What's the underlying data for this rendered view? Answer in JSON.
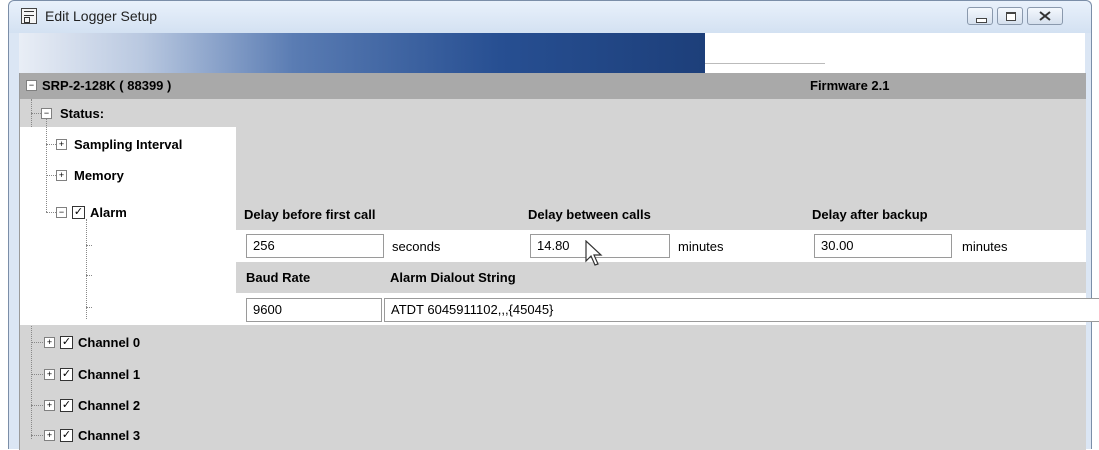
{
  "window": {
    "title": "Edit Logger Setup"
  },
  "device": {
    "name": "SRP-2-128K ( 88399 )",
    "firmware": "Firmware 2.1"
  },
  "tree": {
    "status_label": "Status:",
    "sampling_label": "Sampling Interval",
    "memory_label": "Memory",
    "alarm_label": "Alarm",
    "alarm_checked": true,
    "channels": [
      {
        "label": "Channel 0",
        "checked": true
      },
      {
        "label": "Channel 1",
        "checked": true
      },
      {
        "label": "Channel 2",
        "checked": true
      },
      {
        "label": "Channel 3",
        "checked": true
      }
    ]
  },
  "alarm": {
    "delay_first_header": "Delay before first call",
    "delay_between_header": "Delay between calls",
    "delay_backup_header": "Delay after backup",
    "delay_first_value": "256",
    "delay_first_unit": "seconds",
    "delay_between_value": "14.80",
    "delay_between_unit": "minutes",
    "delay_backup_value": "30.00",
    "delay_backup_unit": "minutes",
    "baud_header": "Baud Rate",
    "dialout_header": "Alarm Dialout String",
    "baud_value": "9600",
    "dialout_value": "ATDT 6045911102,,,{45045}"
  },
  "icons": {
    "app": "app-form-icon",
    "minimize": "minimize-icon",
    "maximize": "maximize-icon",
    "close": "close-icon",
    "cursor": "mouse-pointer-icon"
  }
}
